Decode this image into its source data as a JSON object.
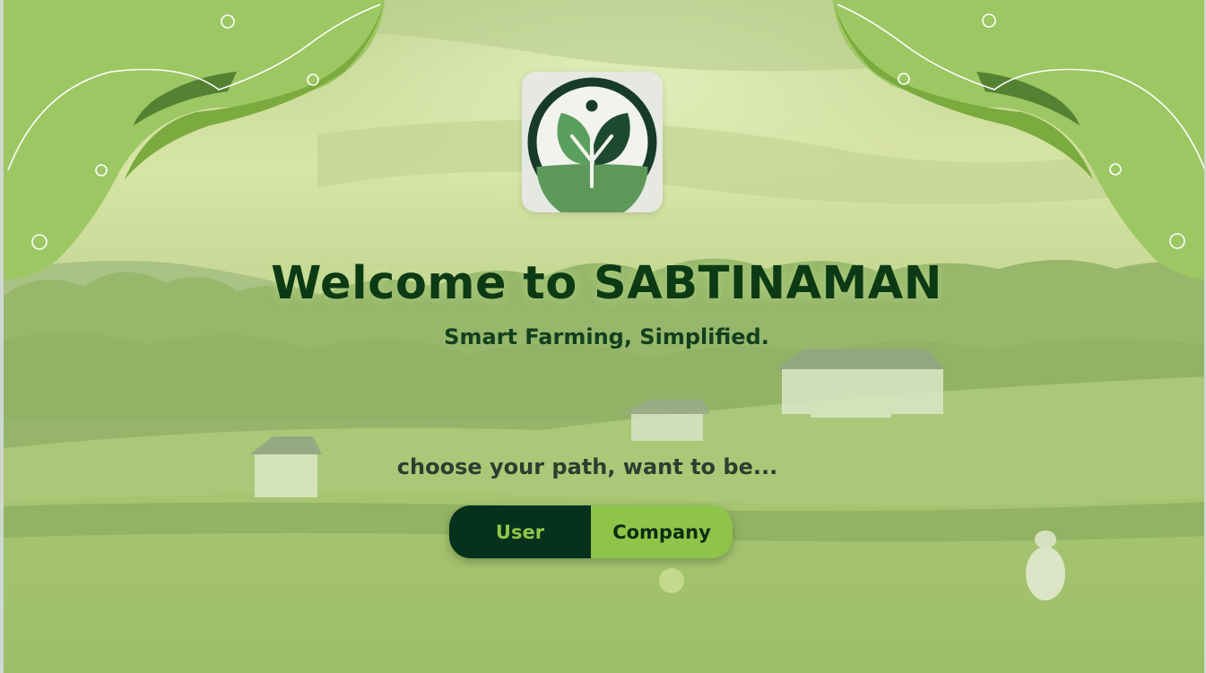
{
  "welcome_title": "Welcome to SABTINAMAN",
  "tagline": "Smart Farming, Simplified.",
  "path_prompt": "choose your path, want to be...",
  "role_toggle": {
    "user_label": "User",
    "company_label": "Company",
    "selected": "User"
  },
  "icons": {
    "logo": "leaf-sprout-logo-icon",
    "corner_left": "leaf-decoration-icon",
    "corner_right": "leaf-decoration-icon"
  },
  "colors": {
    "brand_dark": "#05311d",
    "brand_green": "#8ec447",
    "leaf_light": "#9cc763",
    "title": "#0c3a14"
  }
}
